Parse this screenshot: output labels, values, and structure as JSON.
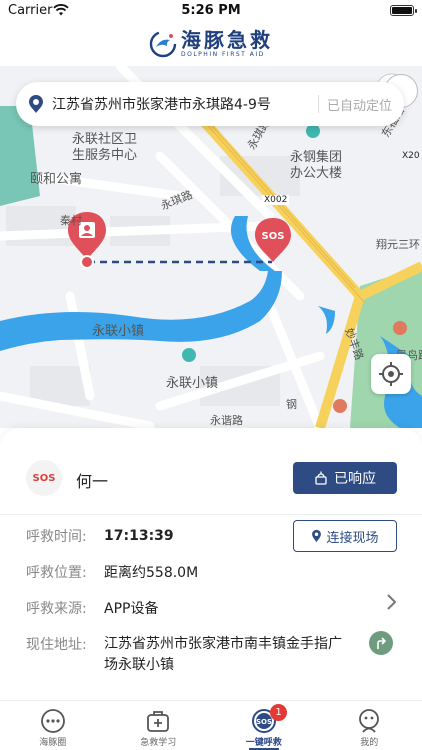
{
  "status_bar": {
    "carrier": "Carrier",
    "time": "5:26 PM"
  },
  "brand": {
    "name_cn": "海豚急救",
    "name_en": "DOLPHIN FIRST AID"
  },
  "location": {
    "address": "江苏省苏州市张家港市永琪路4-9号",
    "auto_label": "已自动定位"
  },
  "map": {
    "labels": [
      "永联社区卫",
      "生服务中心",
      "颐和公寓",
      "永琪路",
      "永钢集团",
      "办公大楼",
      "永联小镇",
      "永联小镇",
      "妙丰路",
      "钢",
      "永谐路",
      "翔元三环",
      "永琪路",
      "X002",
      "X20",
      "凤鸟跳",
      "东福路",
      "秦村"
    ],
    "sos_marker": "SOS"
  },
  "responder": {
    "sos_badge": "SOS",
    "name": "何一",
    "responded_label": "已响应"
  },
  "details": {
    "call_time_label": "呼救时间:",
    "call_time": "17:13:39",
    "call_location_label": "呼救位置:",
    "call_location": "距离约558.0M",
    "source_label": "呼救来源:",
    "source": "APP设备",
    "address_label": "现住地址:",
    "address": "江苏省苏州市张家港市南丰镇金手指广场永联小镇",
    "connect_label": "连接现场"
  },
  "tabs": [
    {
      "label": "海豚圈",
      "icon": "chat-bubble-icon"
    },
    {
      "label": "急救学习",
      "icon": "first-aid-kit-icon"
    },
    {
      "label": "一键呼救",
      "icon": "sos-icon",
      "badge": "1",
      "active": true
    },
    {
      "label": "我的",
      "icon": "profile-icon"
    }
  ],
  "colors": {
    "primary": "#2e4b84",
    "sos_red": "#e0505a",
    "water": "#3aa0e8",
    "road_yellow": "#f5d15a",
    "park_green": "#8fd0a2"
  }
}
